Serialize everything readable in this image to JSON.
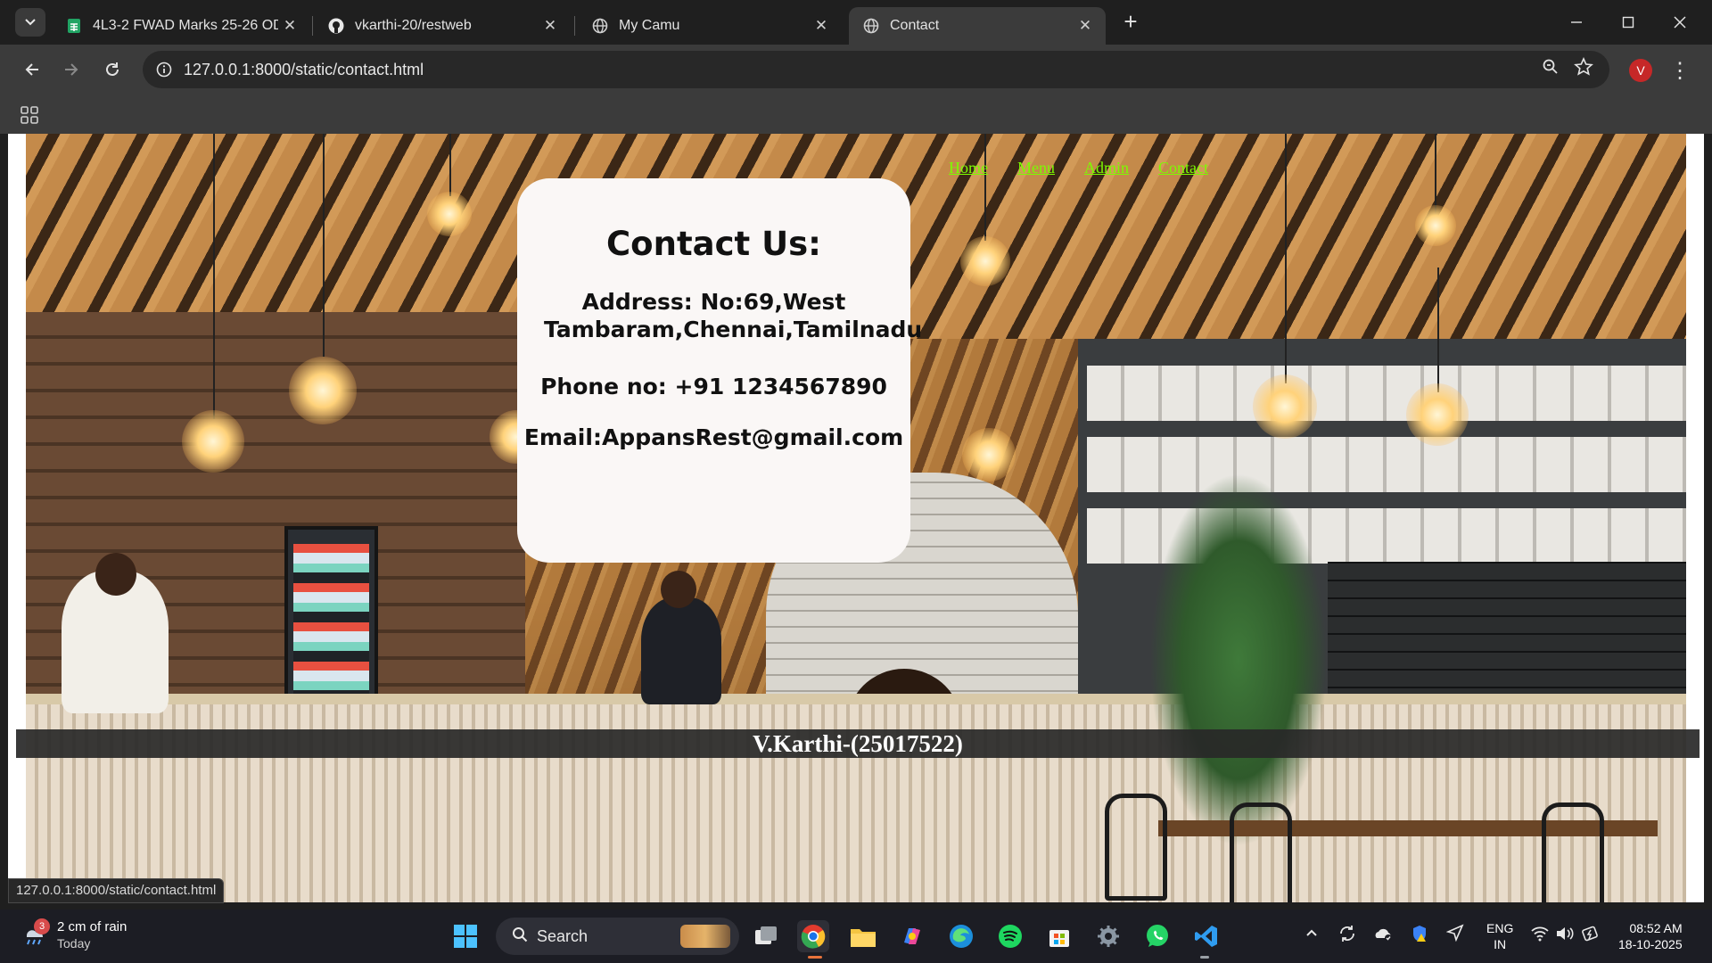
{
  "browser": {
    "tabs": [
      {
        "title": "4L3-2 FWAD Marks 25-26 ODD",
        "icon": "sheets-icon"
      },
      {
        "title": "vkarthi-20/restweb",
        "icon": "github-icon"
      },
      {
        "title": "My Camu",
        "icon": "globe-icon"
      },
      {
        "title": "Contact",
        "icon": "globe-icon",
        "active": true
      }
    ],
    "url": "127.0.0.1:8000/static/contact.html",
    "profile_initial": "V",
    "status_url": "127.0.0.1:8000/static/contact.html"
  },
  "page": {
    "nav": [
      "Home",
      "Menu",
      "Admin",
      "Contact"
    ],
    "card": {
      "heading": "Contact Us:",
      "address": "Address: No:69,West Tambaram,Chennai,Tamilnadu",
      "phone": "Phone no: +91 1234567890",
      "email": "Email:AppansRest@gmail.com"
    },
    "footer": "V.Karthi-(25017522)"
  },
  "taskbar": {
    "weather_badge": "3",
    "weather_main": "2 cm of rain",
    "weather_sub": "Today",
    "search_label": "Search",
    "lang_top": "ENG",
    "lang_bottom": "IN",
    "time": "08:52 AM",
    "date": "18-10-2025"
  },
  "colors": {
    "nav_link": "#7cfc00",
    "card_bg": "#faf7f6",
    "footer_band": "#282828"
  }
}
